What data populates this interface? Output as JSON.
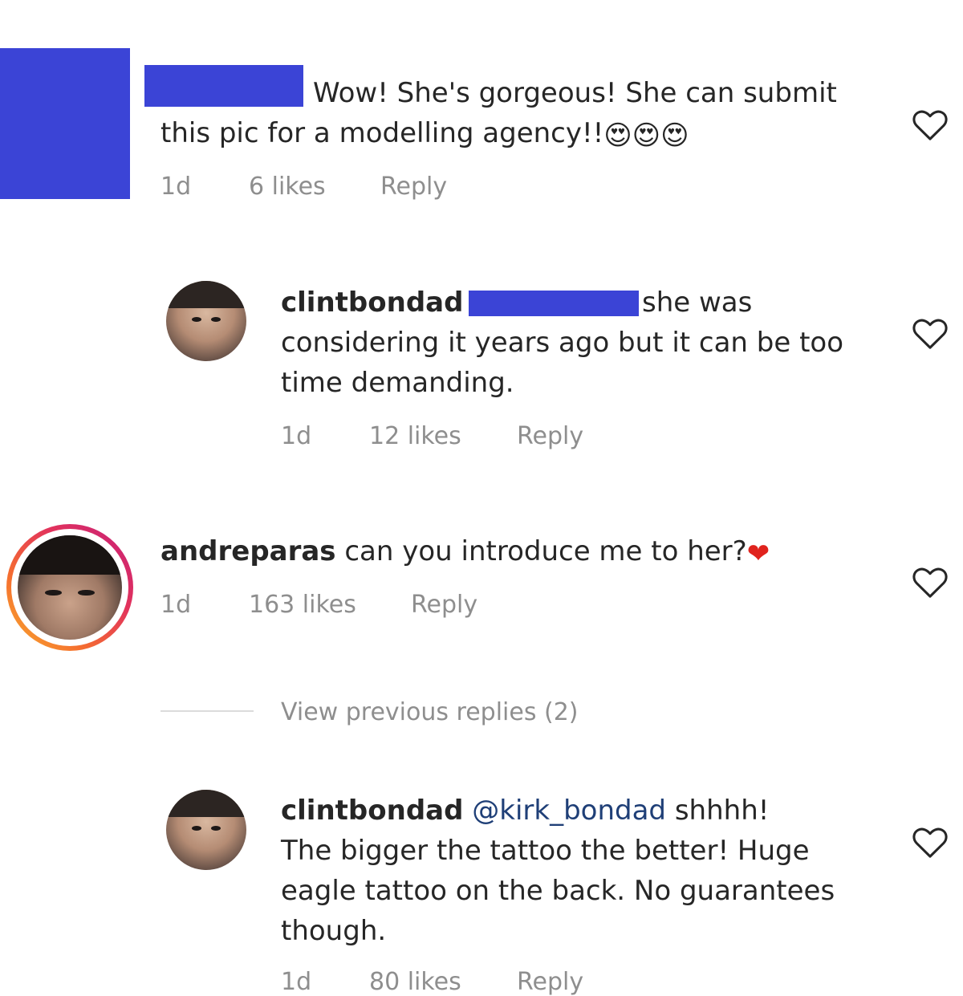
{
  "comments": [
    {
      "text_pre": "Wow! She's gorgeous! She can submit",
      "text_line2": "this pic for a modelling agency!!",
      "emoji": "😍😍😍",
      "time": "1d",
      "likes": "6 likes",
      "reply": "Reply"
    },
    {
      "username": "clintbondad",
      "mention_prefix": "@",
      "text_after": "she was",
      "text_line2": "considering it years ago but it can be too",
      "text_line3": "time demanding.",
      "time": "1d",
      "likes": "12 likes",
      "reply": "Reply"
    },
    {
      "username": "andreparas",
      "text": "can you introduce me to her?",
      "emoji": "❤",
      "time": "1d",
      "likes": "163 likes",
      "reply": "Reply"
    },
    {
      "username": "clintbondad",
      "mention": "@kirk_bondad",
      "text_after": "shhhh!",
      "text_line2": "The bigger the tattoo the better! Huge",
      "text_line3": "eagle tattoo on the back. No guarantees",
      "text_line4": "though.",
      "time": "1d",
      "likes": "80 likes",
      "reply": "Reply"
    }
  ],
  "view_previous_replies": "View previous replies (2)",
  "colors": {
    "redaction": "#3b44d6",
    "meta_text": "#8e8e8e",
    "mention": "#1f3f77",
    "heart_emoji": "#e0231d"
  },
  "icons": [
    "heart-outline-icon",
    "heart-emoji-icon",
    "heart-eyes-emoji-icon"
  ]
}
